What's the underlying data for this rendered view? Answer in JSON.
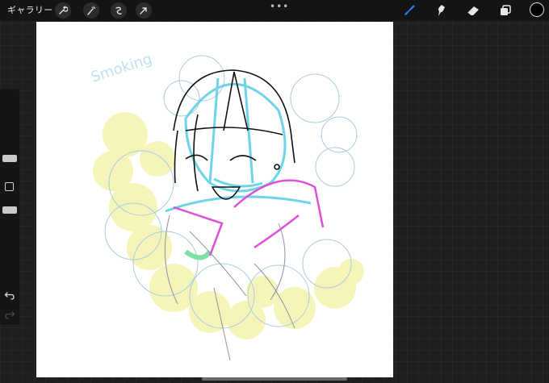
{
  "topbar": {
    "gallery_label": "ギャラリー",
    "left_tools": [
      {
        "icon": "wrench-icon",
        "label": "Actions"
      },
      {
        "icon": "magic-wand-icon",
        "label": "Adjustments"
      },
      {
        "icon": "selection-icon",
        "label": "Selection"
      },
      {
        "icon": "transform-arrow-icon",
        "label": "Transform"
      }
    ],
    "more_label": "•••",
    "right_tools": [
      {
        "icon": "brush-icon",
        "label": "Paint",
        "active": true
      },
      {
        "icon": "smudge-icon",
        "label": "Smudge"
      },
      {
        "icon": "eraser-icon",
        "label": "Erase"
      },
      {
        "icon": "layers-icon",
        "label": "Layers"
      }
    ],
    "active_color": "#000000",
    "accent": "#2f7bf5"
  },
  "canvas": {
    "sketch_text": "Smoking",
    "background": "#ffffff"
  },
  "sidebar": {
    "brush_size_level": 0.3,
    "opacity_level": 0.4
  }
}
